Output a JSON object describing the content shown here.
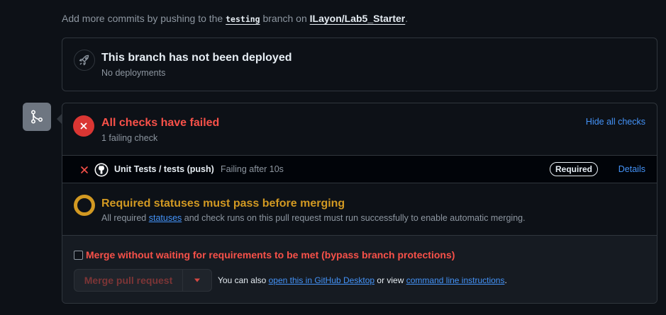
{
  "hint": {
    "prefix": "Add more commits by pushing to the",
    "branch": "testing",
    "middle": "branch on",
    "repo": "ILayon/Lab5_Starter",
    "suffix": "."
  },
  "deploy": {
    "icon": "rocket-icon",
    "title": "This branch has not been deployed",
    "subtitle": "No deployments"
  },
  "timeline": {
    "icon": "git-merge-icon"
  },
  "checks": {
    "title": "All checks have failed",
    "subtitle": "1 failing check",
    "hide_link": "Hide all checks",
    "items": [
      {
        "name": "Unit Tests / tests (push)",
        "status": "Failing after 10s",
        "badge": "Required",
        "details": "Details"
      }
    ]
  },
  "required": {
    "title": "Required statuses must pass before merging",
    "text_prefix": "All required",
    "link": "statuses",
    "text_suffix": "and check runs on this pull request must run successfully to enable automatic merging."
  },
  "merge": {
    "bypass_label": "Merge without waiting for requirements to be met (bypass branch protections)",
    "button_label": "Merge pull request",
    "also_prefix": "You can also",
    "desktop_link": "open this in GitHub Desktop",
    "also_middle": "or view",
    "cli_link": "command line instructions",
    "also_suffix": "."
  },
  "colors": {
    "danger": "#f85149",
    "attention": "#d29922",
    "accent": "#4493f8",
    "background": "#0d1117"
  }
}
